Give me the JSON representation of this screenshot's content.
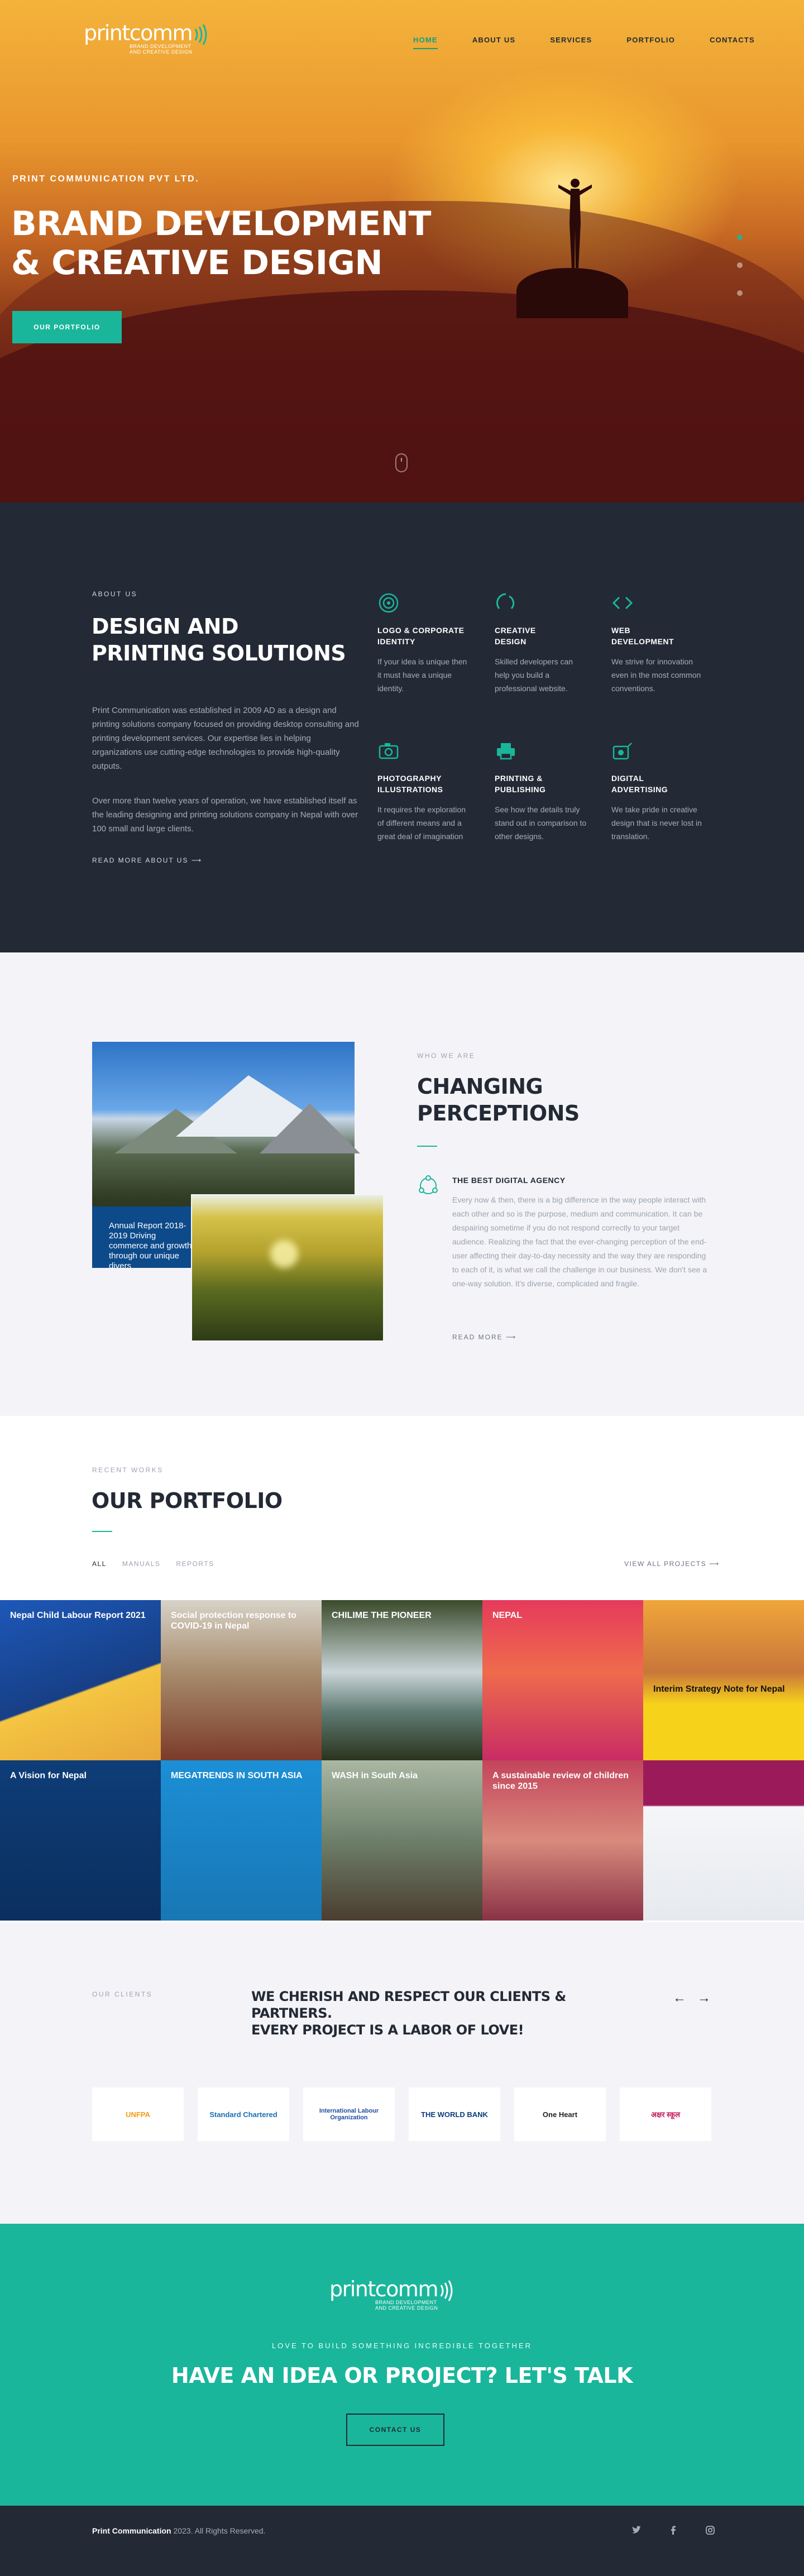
{
  "brand": {
    "logo_word": "printcomm",
    "logo_sub_line1": "BRAND DEVELOPMENT",
    "logo_sub_line2": "AND CREATIVE DESIGN"
  },
  "nav": {
    "items": [
      {
        "label": "HOME",
        "active": true
      },
      {
        "label": "ABOUT US"
      },
      {
        "label": "SERVICES"
      },
      {
        "label": "PORTFOLIO"
      },
      {
        "label": "CONTACTS"
      }
    ]
  },
  "hero": {
    "tag": "PRINT COMMUNICATION PVT LTD.",
    "title_line1": "BRAND DEVELOPMENT",
    "title_line2": "& CREATIVE DESIGN",
    "button": "OUR PORTFOLIO"
  },
  "about": {
    "kicker": "ABOUT US",
    "title_line1": "DESIGN AND",
    "title_line2": "PRINTING SOLUTIONS",
    "p1": "Print Communication was established in 2009 AD as a design and printing solutions company focused on providing desktop consulting and printing development services. Our expertise lies in helping organizations use cutting-edge technologies to provide high-quality outputs.",
    "p2": "Over more than twelve years of operation, we have established itself as the leading designing and printing solutions company in Nepal with over 100 small and large clients.",
    "read_more": "READ MORE ABOUT US",
    "features": [
      {
        "title1": "LOGO & CORPORATE",
        "title2": "IDENTITY",
        "text": "If your idea is unique then it must have a unique identity.",
        "icon": "target-icon"
      },
      {
        "title1": "CREATIVE",
        "title2": "DESIGN",
        "text": "Skilled developers can help you build a professional website.",
        "icon": "loader-icon"
      },
      {
        "title1": "WEB",
        "title2": "DEVELOPMENT",
        "text": "We strive for innovation even in the most common conventions.",
        "icon": "code-icon"
      },
      {
        "title1": "PHOTOGRAPHY",
        "title2": "ILLUSTRATIONS",
        "text": "It requires the exploration of different means and a great deal of imagination",
        "icon": "camera-icon"
      },
      {
        "title1": "PRINTING & PUBLISHING",
        "title2": "",
        "text": "See how the details truly stand out in comparison to other designs.",
        "icon": "printer-icon"
      },
      {
        "title1": "DIGITAL",
        "title2": "ADVERTISING",
        "text": "We take pride in creative design that is never lost in translation.",
        "icon": "ad-icon"
      }
    ]
  },
  "who": {
    "kicker": "WHO WE ARE",
    "title_line1": "CHANGING",
    "title_line2": "PERCEPTIONS",
    "img_caption": "Annual Report 2018-2019 Driving commerce and growth through our unique divers",
    "agency_title": "THE BEST DIGITAL AGENCY",
    "agency_text": "Every now & then, there is a big difference in the way people interact with each other and so is the purpose, medium and communication. It can be despairing sometime if you do not respond correctly to your target audience. Realizing the fact that the ever-changing perception of the end-user affecting their day-to-day necessity and the way they are responding to each of it, is what we call the challenge in our business. We don't see a one-way solution. It's diverse, complicated and fragile.",
    "read_more": "READ MORE"
  },
  "portfolio": {
    "kicker": "RECENT WORKS",
    "title": "OUR PORTFOLIO",
    "filters": [
      "ALL",
      "MANUALS",
      "REPORTS"
    ],
    "view_all": "VIEW ALL PROJECTS",
    "tiles": [
      {
        "title": "Nepal Child Labour Report 2021",
        "bg": "#1a4a9c"
      },
      {
        "title": "Social protection response to COVID-19 in Nepal",
        "bg": "#8b6b50"
      },
      {
        "title": "CHILIME THE PIONEER",
        "bg": "#2f3b22"
      },
      {
        "title": "NEPAL",
        "bg": "#e63a5c"
      },
      {
        "title": "Interim Strategy Note for Nepal",
        "bg": "#c97a2a"
      },
      {
        "title": "A Vision for Nepal",
        "bg": "#0e3d78"
      },
      {
        "title": "MEGATRENDS IN SOUTH ASIA",
        "bg": "#1c8fd6"
      },
      {
        "title": "WASH in South Asia",
        "bg": "#6d7f6a"
      },
      {
        "title": "A sustainable review of children since 2015",
        "bg": "#b5475a"
      },
      {
        "title": "",
        "bg": "#eef0f4"
      }
    ]
  },
  "clients": {
    "kicker": "OUR CLIENTS",
    "heading_line1": "WE CHERISH AND RESPECT OUR CLIENTS & PARTNERS.",
    "heading_line2": "EVERY PROJECT IS A LABOR OF LOVE!",
    "prev": "←",
    "next": "→",
    "logos": [
      "UNFPA",
      "Standard Chartered",
      "International Labour Organization",
      "THE WORLD BANK",
      "One Heart",
      "अक्षर स्कूल"
    ]
  },
  "cta": {
    "tagline": "LOVE TO BUILD SOMETHING INCREDIBLE TOGETHER",
    "heading": "HAVE AN IDEA OR PROJECT? LET'S TALK",
    "button": "CONTACT US"
  },
  "footer": {
    "brand": "Print Communication",
    "copyright": " 2023. All Rights Reserved."
  },
  "colors": {
    "accent": "#1ab69b",
    "dark": "#232a35",
    "light": "#f4f4f8"
  }
}
